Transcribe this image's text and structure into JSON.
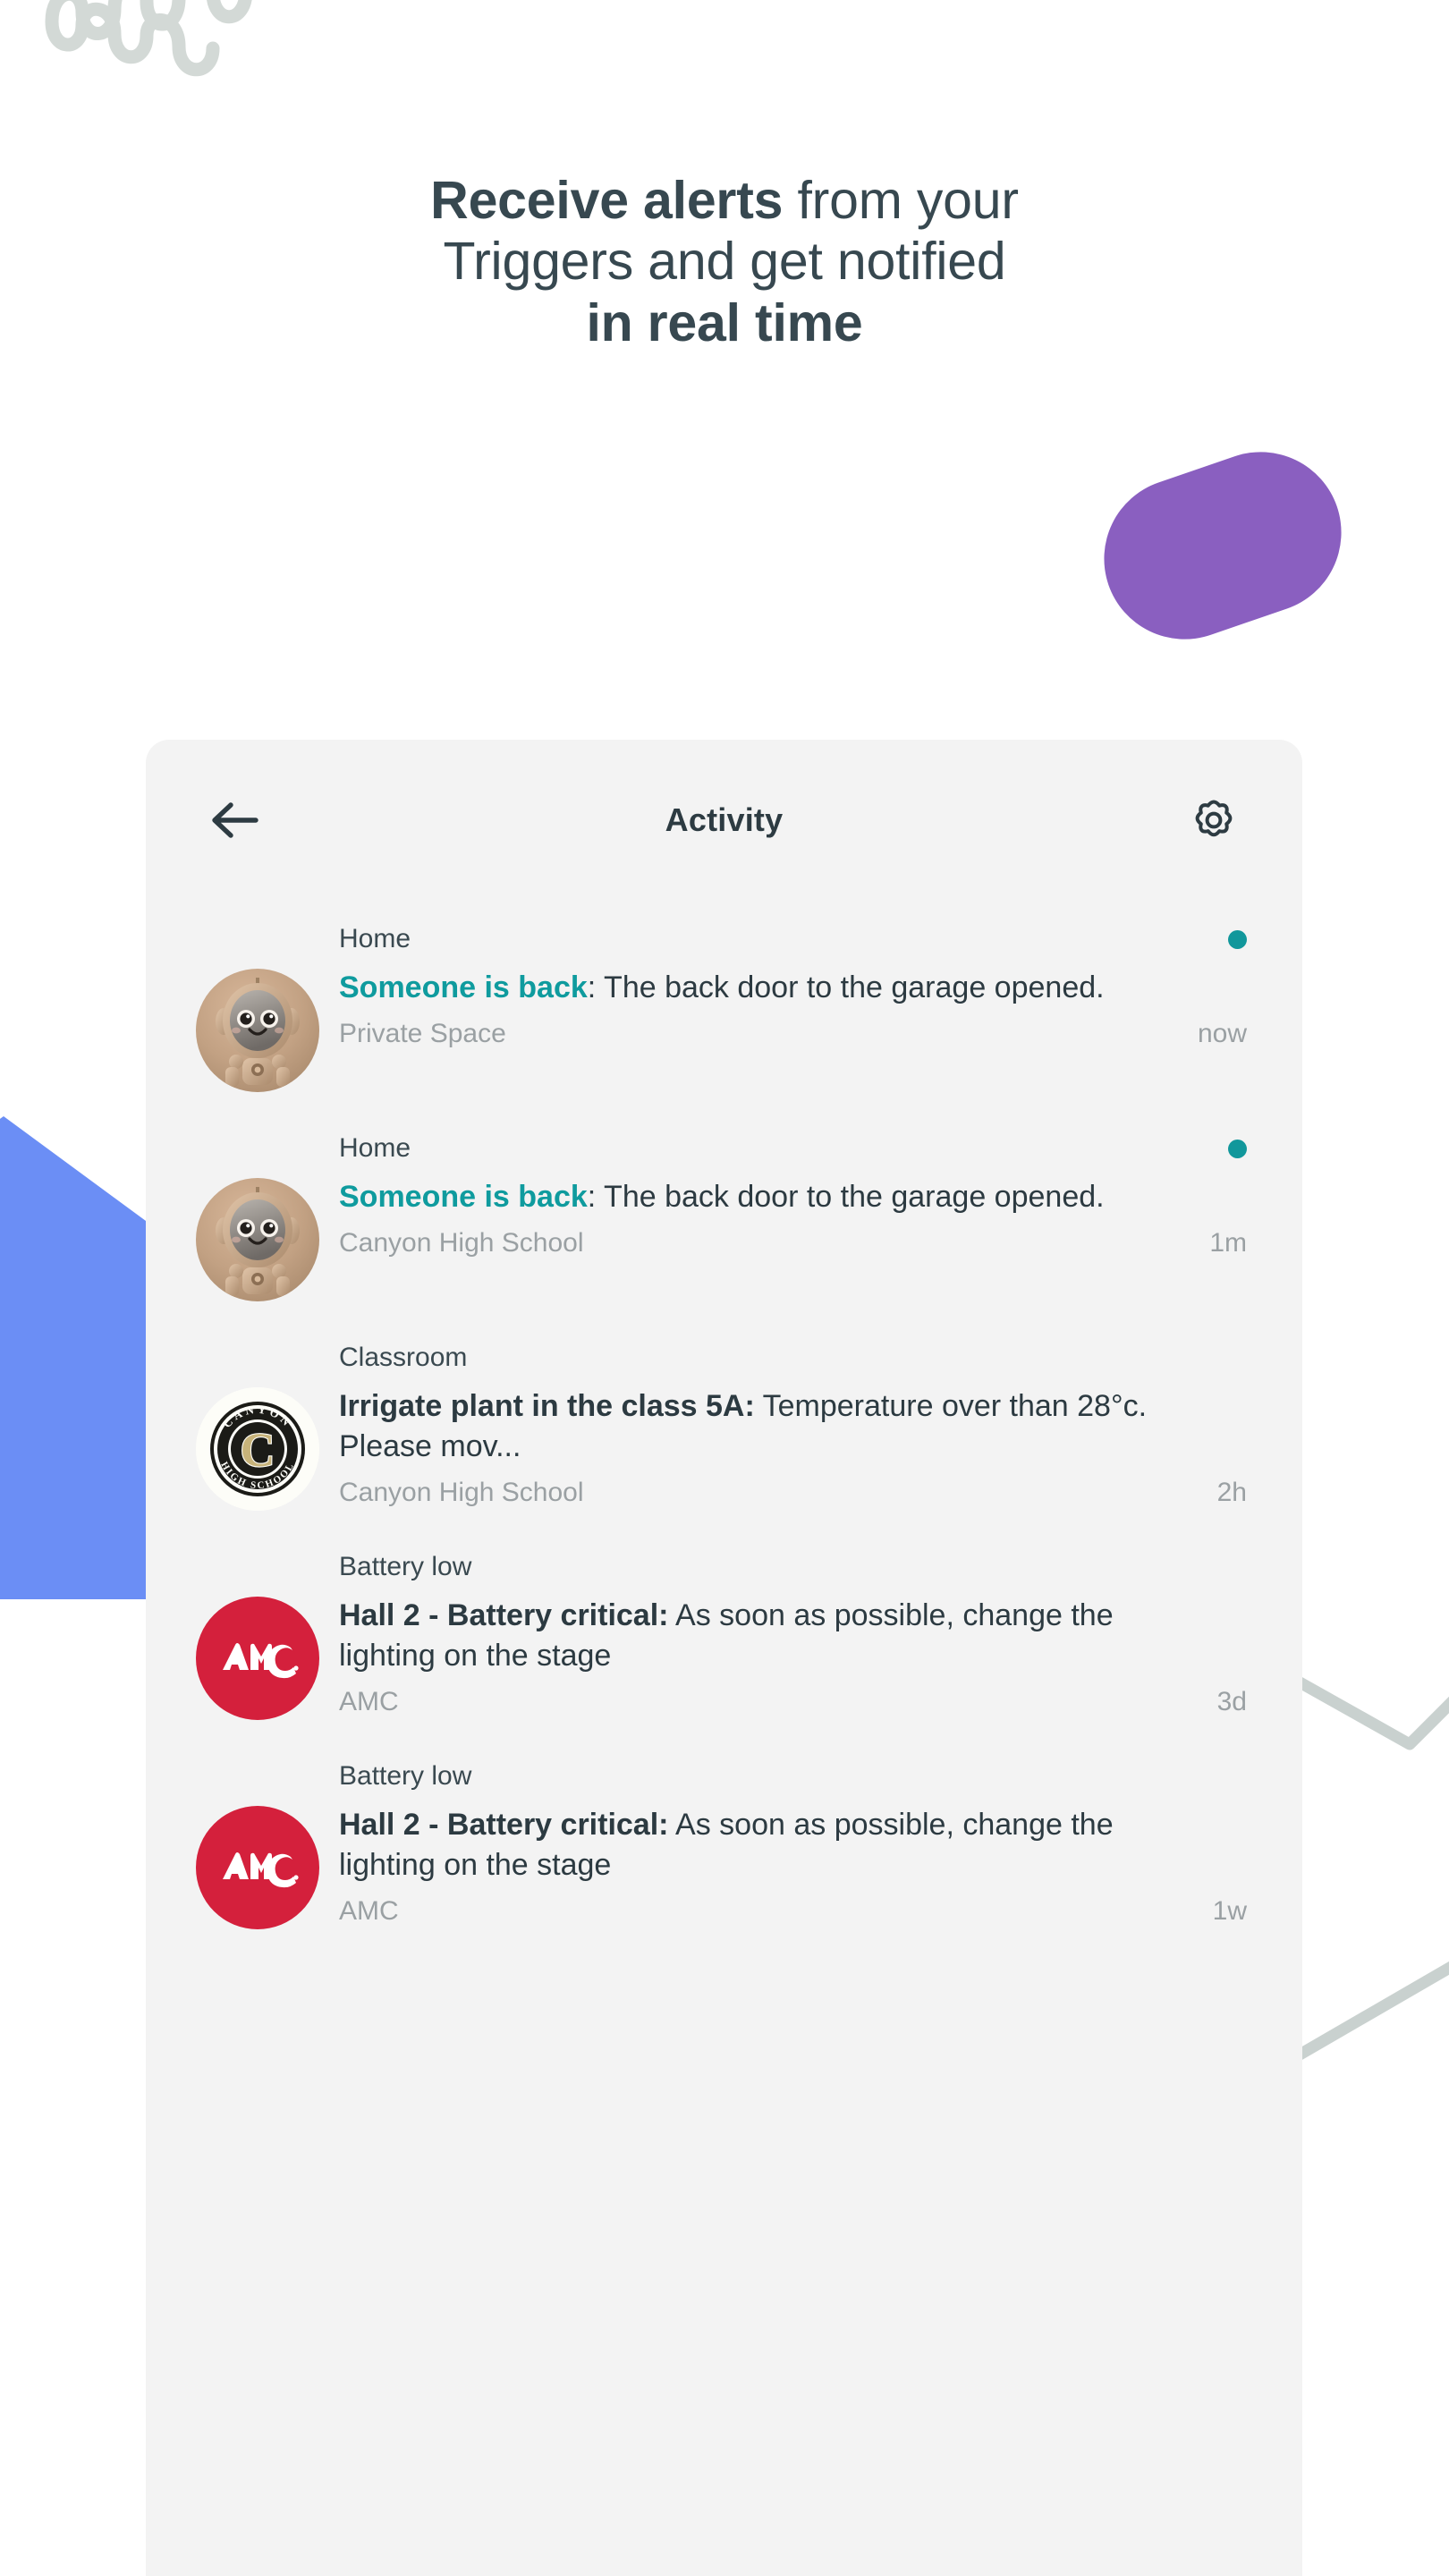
{
  "headline": {
    "line1_bold": "Receive alerts",
    "line1_rest": " from your",
    "line2": "Triggers and get notified",
    "line3_bold": "in real time"
  },
  "card": {
    "title": "Activity",
    "back_icon": "arrow-left-icon",
    "settings_icon": "gear-icon"
  },
  "colors": {
    "accent_teal": "#11979b",
    "purple_blob": "#8a5fc0",
    "blue_polygon": "#6b8ef5",
    "grey_line": "#c9d1cf",
    "card_bg": "#f3f3f3",
    "heading_text": "#374850",
    "amc_red": "#d4203c",
    "school_gold": "#c7b37a"
  },
  "notifications": [
    {
      "category": "Home",
      "lead": "Someone is back",
      "lead_style": "teal",
      "body": ": The back door to the garage opened.",
      "source": "Private Space",
      "time": "now",
      "unread": true,
      "avatar": "robot-avatar"
    },
    {
      "category": "Home",
      "lead": "Someone is back",
      "lead_style": "teal",
      "body": ": The back door to the garage opened.",
      "source": "Canyon High School",
      "time": "1m",
      "unread": true,
      "avatar": "robot-avatar"
    },
    {
      "category": "Classroom",
      "lead": "Irrigate plant in the class 5A:",
      "lead_style": "dark",
      "body": " Temperature over than 28°c. Please mov...",
      "source": "Canyon High School",
      "time": "2h",
      "unread": false,
      "avatar": "canyon-high-school-logo"
    },
    {
      "category": "Battery low",
      "lead": "Hall 2 - Battery critical:",
      "lead_style": "dark",
      "body": " As soon as possible, change the lighting on the stage",
      "source": "AMC",
      "time": "3d",
      "unread": false,
      "avatar": "amc-logo"
    },
    {
      "category": "Battery low",
      "lead": "Hall 2 - Battery critical:",
      "lead_style": "dark",
      "body": " As soon as possible, change the lighting on the stage",
      "source": "AMC",
      "time": "1w",
      "unread": false,
      "avatar": "amc-logo"
    }
  ],
  "school_badge": {
    "top_arc": "CANYON",
    "bottom_arc": "HIGH SCHOOL",
    "center_letter": "C"
  },
  "amc_badge": {
    "wordmark": "AMC"
  }
}
